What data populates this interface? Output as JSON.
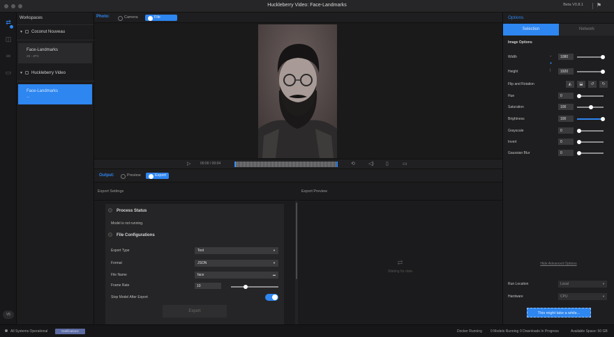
{
  "window": {
    "title": "Huckleberry Video: Face-Landmarks",
    "beta": "Beta V0.8.1"
  },
  "rail": {
    "version": "V5"
  },
  "workspaces": {
    "header": "Workspaces",
    "groups": [
      {
        "name": "Coconut Nouveau",
        "items": [
          {
            "name": "Face-Landmarks",
            "sub": "28 - JPG"
          }
        ]
      },
      {
        "name": "Huckleberry Video",
        "items": [
          {
            "name": "Face-Landmarks",
            "sub": "—"
          }
        ]
      }
    ]
  },
  "photo_bar": {
    "label": "Photo:",
    "options": [
      "Camera",
      "File"
    ],
    "selected": "File"
  },
  "player": {
    "time": "00:00 / 00:04"
  },
  "output_bar": {
    "label": "Output:",
    "options": [
      "Preview",
      "Export"
    ],
    "selected": "Export"
  },
  "export_settings": {
    "header": "Export Settings",
    "process_status": {
      "title": "Process Status",
      "text": "Model is not running."
    },
    "file_config": {
      "title": "File Configurations",
      "export_type_label": "Export Type",
      "export_type_value": "Text",
      "format_label": "Format",
      "format_value": "JSON",
      "file_name_label": "File Name",
      "file_name_value": "face",
      "frame_rate_label": "Frame Rate",
      "frame_rate_value": "10",
      "stop_model_label": "Stop Model After Export",
      "stop_model_on": true,
      "export_button": "Export"
    }
  },
  "export_preview": {
    "header": "Export Preview",
    "waiting": "Waiting for data"
  },
  "options": {
    "header": "Options",
    "tabs": [
      "Selection",
      "Network"
    ],
    "active_tab": "Selection",
    "image_options_title": "Image Options",
    "width_label": "Width",
    "width_value": "1080",
    "height_label": "Height",
    "height_value": "1920",
    "flip_label": "Flip and Rotation",
    "hue_label": "Hue",
    "hue_value": "0",
    "saturation_label": "Saturation",
    "saturation_value": "100",
    "brightness_label": "Brightness",
    "brightness_value": "100",
    "grayscale_label": "Grayscale",
    "grayscale_value": "0",
    "invert_label": "Invert",
    "invert_value": "0",
    "blur_label": "Gaussian Blur",
    "blur_value": "0",
    "advanced_link": "Hide Advanced Options",
    "run_location_label": "Run Location",
    "run_location_value": "Local",
    "hardware_label": "Hardware",
    "hardware_value": "CPU",
    "run_button": "This might take a while..."
  },
  "status": {
    "systems": "All Systems Operational",
    "pill": "Notifications",
    "docker": "Docker Running",
    "models": "0 Models Running",
    "downloads": "0 Downloads In Progress",
    "space": "Available Space: 50 GB"
  },
  "colors": {
    "accent": "#2e86f0",
    "background": "#1b1b1d"
  }
}
